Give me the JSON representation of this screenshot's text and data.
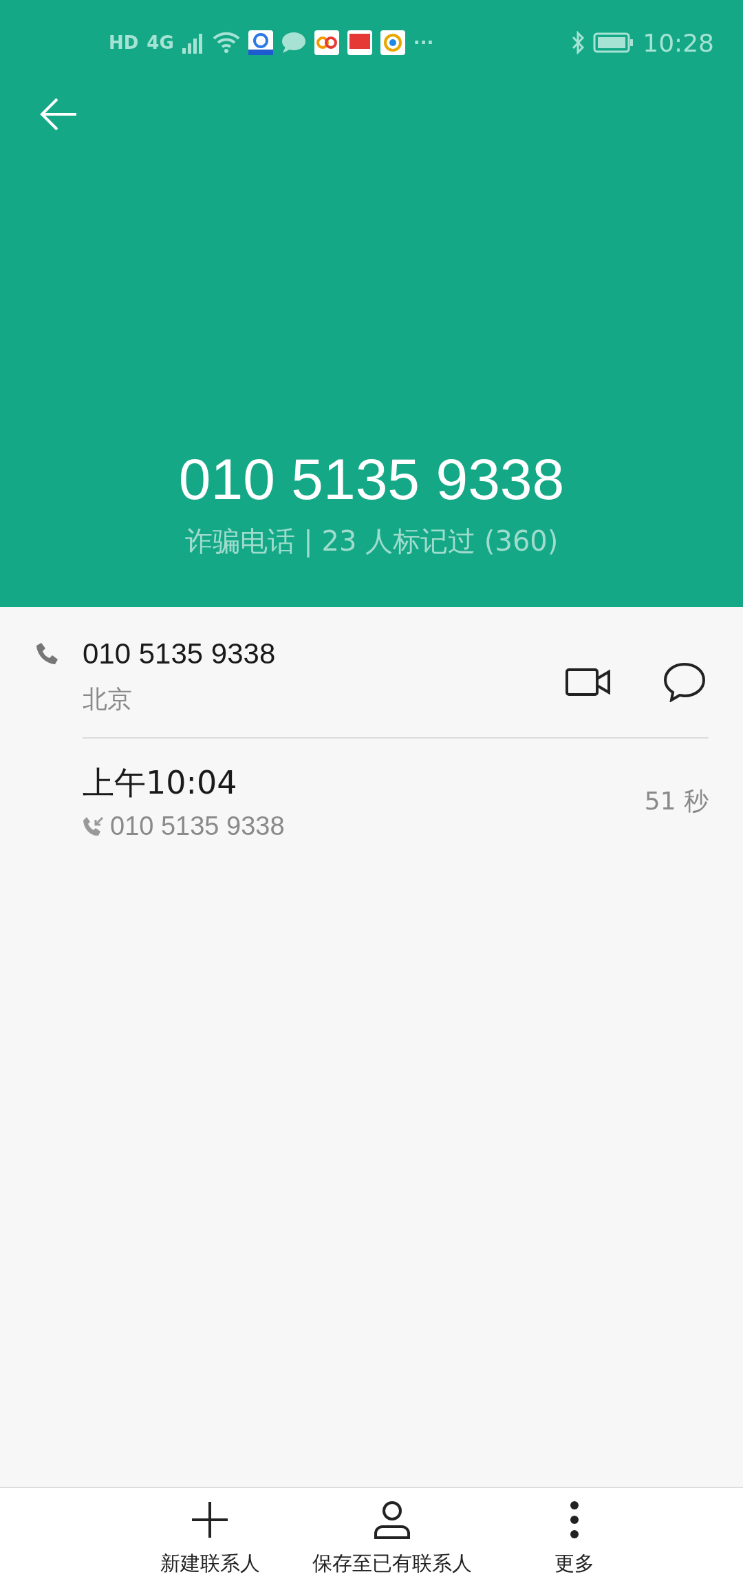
{
  "status_bar": {
    "network_labels": [
      "HD",
      "4G"
    ],
    "more": "···",
    "time": "10:28"
  },
  "header": {
    "number": "010 5135 9338",
    "tag": "诈骗电话 | 23 人标记过 (360)"
  },
  "contact": {
    "number": "010 5135 9338",
    "location": "北京"
  },
  "call_log": [
    {
      "time": "上午10:04",
      "number": "010 5135 9338",
      "duration": "51 秒",
      "kind": "incoming"
    }
  ],
  "bottom_bar": [
    {
      "label": "新建联系人",
      "kind": "add"
    },
    {
      "label": "保存至已有联系人",
      "kind": "person"
    },
    {
      "label": "更多",
      "kind": "more"
    }
  ]
}
